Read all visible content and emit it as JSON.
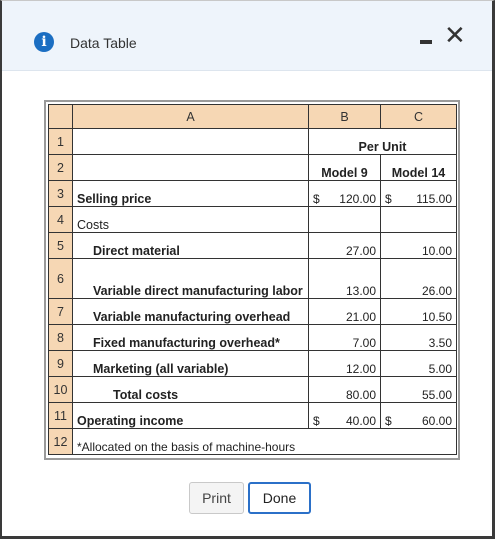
{
  "dialog": {
    "title": "Data Table",
    "info_icon": "info-icon",
    "minimize_label": "–",
    "close_label": "✕"
  },
  "table": {
    "column_headers": [
      "A",
      "B",
      "C"
    ],
    "rows": [
      {
        "n": "1",
        "a": "",
        "b": "Per Unit",
        "c": ""
      },
      {
        "n": "2",
        "a": "",
        "b": "Model 9",
        "c": "Model 14"
      },
      {
        "n": "3",
        "a": "Selling price",
        "b_cur": "$",
        "b": "120.00",
        "c_cur": "$",
        "c": "115.00"
      },
      {
        "n": "4",
        "a": "Costs",
        "b": "",
        "c": ""
      },
      {
        "n": "5",
        "a": "Direct material",
        "b": "27.00",
        "c": "10.00"
      },
      {
        "n": "6",
        "a": "Variable direct manufacturing labor",
        "b": "13.00",
        "c": "26.00"
      },
      {
        "n": "7",
        "a": "Variable manufacturing overhead",
        "b": "21.00",
        "c": "10.50"
      },
      {
        "n": "8",
        "a": "Fixed manufacturing overhead*",
        "b": "7.00",
        "c": "3.50"
      },
      {
        "n": "9",
        "a": "Marketing (all variable)",
        "b": "12.00",
        "c": "5.00"
      },
      {
        "n": "10",
        "a": "Total costs",
        "b": "80.00",
        "c": "55.00"
      },
      {
        "n": "11",
        "a": "Operating income",
        "b_cur": "$",
        "b": "40.00",
        "c_cur": "$",
        "c": "60.00"
      },
      {
        "n": "12",
        "a": "*Allocated on the basis of machine-hours"
      }
    ]
  },
  "buttons": {
    "print": "Print",
    "done": "Done"
  },
  "colors": {
    "header_fill": "#f6d7b4",
    "titlebar_fill": "#eef4fb",
    "accent": "#2b70c8"
  }
}
